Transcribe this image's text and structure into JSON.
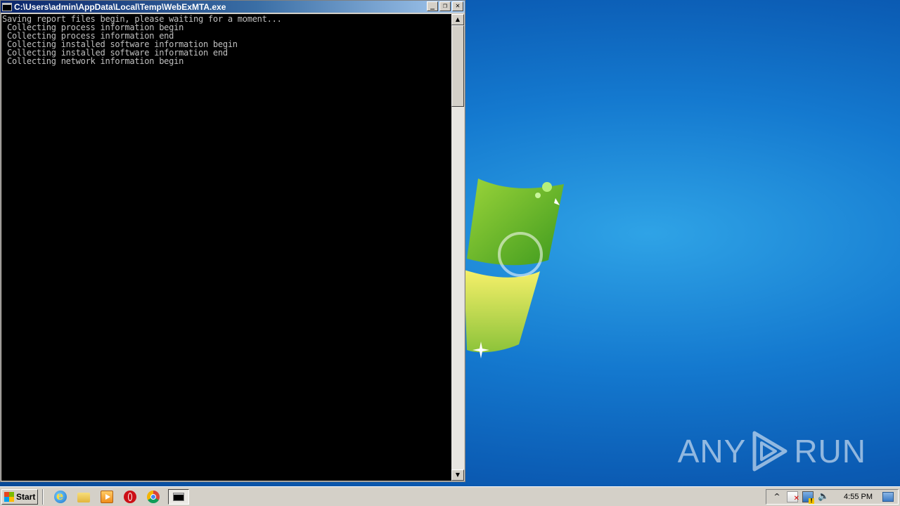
{
  "window": {
    "title": "C:\\Users\\admin\\AppData\\Local\\Temp\\WebExMTA.exe",
    "minimize_glyph": "_",
    "restore_glyph": "❐",
    "close_glyph": "✕"
  },
  "console": {
    "lines": [
      "Saving report files begin, please waiting for a moment...",
      " Collecting process information begin",
      " Collecting process information end",
      " Collecting installed software information begin",
      " Collecting installed software information end",
      " Collecting network information begin"
    ]
  },
  "scrollbar": {
    "up_glyph": "▲",
    "down_glyph": "▼"
  },
  "taskbar": {
    "start_label": "Start",
    "quick_launch": [
      "internet-explorer-icon",
      "folder-icon",
      "media-player-icon",
      "opera-icon",
      "chrome-icon"
    ],
    "tray": {
      "expand_glyph": "^",
      "volume_glyph": "🔈",
      "clock": "4:55 PM"
    }
  },
  "desktop": {
    "watermark": "ANY RUN",
    "watermark_left": "ANY",
    "watermark_right": "RUN"
  },
  "colors": {
    "console_bg": "#000000",
    "console_text": "#c0c0c0",
    "titlebar": "#0a246a",
    "desktop": "#1479cf"
  }
}
